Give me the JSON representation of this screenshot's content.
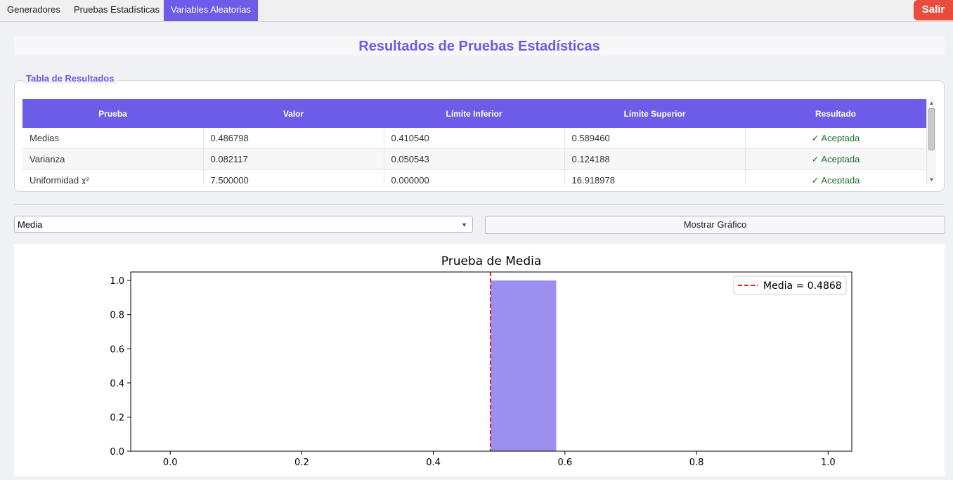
{
  "tabs": [
    {
      "label": "Generadores",
      "active": false
    },
    {
      "label": "Pruebas Estadísticas",
      "active": false
    },
    {
      "label": "Variables Aleatorias",
      "active": true
    }
  ],
  "exit_label": "Salir",
  "page_title": "Resultados de Pruebas Estadísticas",
  "group_title": "Tabla de Resultados",
  "table": {
    "headers": [
      "Prueba",
      "Valor",
      "Límite Inferior",
      "Límite Superior",
      "Resultado"
    ],
    "rows": [
      [
        "Medias",
        "0.486798",
        "0.410540",
        "0.589460",
        "✓ Aceptada"
      ],
      [
        "Varianza",
        "0.082117",
        "0.050543",
        "0.124188",
        "✓ Aceptada"
      ],
      [
        "Uniformidad χ²",
        "7.500000",
        "0.000000",
        "16.918978",
        "✓ Aceptada"
      ]
    ]
  },
  "controls": {
    "test_select_value": "Media",
    "show_button_label": "Mostrar Gráfico"
  },
  "colors": {
    "accent": "#6c5ce7",
    "exit": "#e74c3c",
    "bar": "#9b8ff0",
    "mean_line": "#d62728"
  },
  "chart_data": {
    "type": "bar",
    "title": "Prueba de Media",
    "xlabel": "",
    "ylabel": "",
    "xlim": [
      -0.06,
      1.036
    ],
    "ylim": [
      0,
      1.05
    ],
    "xticks": [
      "0.0",
      "0.2",
      "0.4",
      "0.6",
      "0.8",
      "1.0"
    ],
    "yticks": [
      "0.0",
      "0.2",
      "0.4",
      "0.6",
      "0.8",
      "1.0"
    ],
    "bins": [
      {
        "x0": 0.4868,
        "x1": 0.5868,
        "value": 1.0
      }
    ],
    "mean_line": {
      "x": 0.4868,
      "label": "Media = 0.4868"
    },
    "legend_position": "top-right"
  }
}
